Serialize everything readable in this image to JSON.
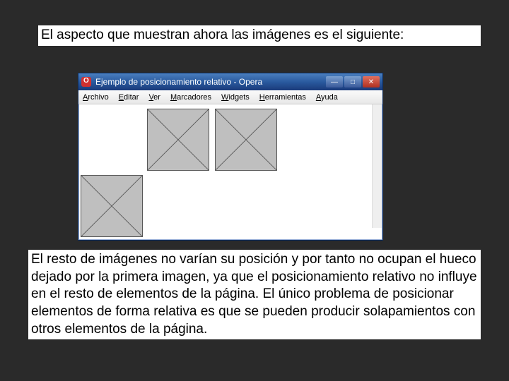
{
  "text_top": "El aspecto que muestran ahora las imágenes es el siguiente:",
  "window": {
    "title": "Ejemplo de posicionamiento relativo - Opera",
    "menu": [
      "Archivo",
      "Editar",
      "Ver",
      "Marcadores",
      "Widgets",
      "Herramientas",
      "Ayuda"
    ],
    "controls": {
      "min": "—",
      "max": "□",
      "close": "✕"
    }
  },
  "text_bottom": "El resto de imágenes no varían su posición y por tanto no ocupan el hueco dejado por la primera imagen, ya que el posicionamiento relativo no influye en el resto de elementos de la página. El único problema de posicionar elementos de forma relativa es que se pueden producir solapamientos con otros elementos de la página."
}
